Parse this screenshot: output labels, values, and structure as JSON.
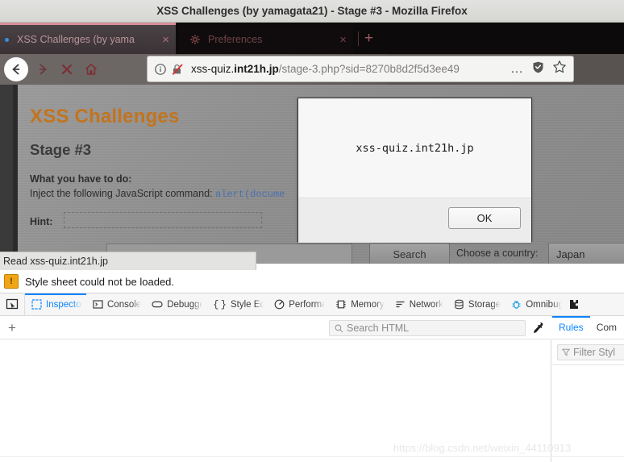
{
  "window": {
    "title": "XSS Challenges (by yamagata21) - Stage #3 - Mozilla Firefox"
  },
  "tabs": [
    {
      "label": "XSS Challenges (by yama",
      "close": "×",
      "active": true,
      "favicon": "dot-icon"
    },
    {
      "label": "Preferences",
      "close": "×",
      "active": false,
      "favicon": "gear-icon"
    }
  ],
  "tabstrip": {
    "new_tab": "+"
  },
  "navbar": {
    "back": "←",
    "forward": "→",
    "stop": "✕",
    "home": "⌂"
  },
  "urlbar": {
    "url_prefix": "xss-quiz.",
    "url_domain": "int21h.jp",
    "url_path": "/stage-3.php?sid=8270b8d2f5d3ee49",
    "full_url": "xss-quiz.int21h.jp/stage-3.php?sid=8270b8d2f5d3ee49",
    "identity_icon": "info-circle-icon",
    "insecure_icon": "broken-lock-icon",
    "page_actions": "…",
    "shield_icon": "shield-icon",
    "bookmark_icon": "star-icon"
  },
  "page": {
    "heading": "XSS Challenges",
    "stage": "Stage #3",
    "todo_label": "What you have to do:",
    "todo_text": "Inject the following JavaScript command: ",
    "todo_code": "alert(docume",
    "hint_label": "Hint:",
    "hint_value": "",
    "search_value": "",
    "search_button": "Search",
    "country_label": "Choose a country:",
    "country_value": "Japan",
    "heading_color": "#c2741f"
  },
  "dialog": {
    "message": "xss-quiz.int21h.jp",
    "ok_button": "OK"
  },
  "statustip": {
    "text": "Read xss-quiz.int21h.jp"
  },
  "notification": {
    "icon": "warning-icon",
    "icon_glyph": "!",
    "text": "Style sheet could not be loaded."
  },
  "devtools": {
    "picker_icon": "element-picker-icon",
    "tabs": [
      {
        "label": "Inspector",
        "icon": "inspector-icon",
        "selected": true
      },
      {
        "label": "Console",
        "icon": "console-icon",
        "selected": false
      },
      {
        "label": "Debugger",
        "icon": "debugger-icon",
        "selected": false
      },
      {
        "label": "Style Editor",
        "icon": "style-editor-icon",
        "selected": false
      },
      {
        "label": "Performance",
        "icon": "performance-icon",
        "selected": false
      },
      {
        "label": "Memory",
        "icon": "memory-icon",
        "selected": false
      },
      {
        "label": "Network",
        "icon": "network-icon",
        "selected": false
      },
      {
        "label": "Storage",
        "icon": "storage-icon",
        "selected": false
      },
      {
        "label": "Omnibug",
        "icon": "omnibug-icon",
        "selected": false
      }
    ],
    "add_node": "+",
    "search_html_placeholder": "Search HTML",
    "search_html_icon": "search-icon",
    "eyedropper_icon": "eyedropper-icon",
    "right_tabs": [
      {
        "label": "Rules",
        "selected": true
      },
      {
        "label": "Com",
        "selected": false
      }
    ],
    "filter_placeholder": "Filter Styl",
    "filter_icon": "filter-icon",
    "accent_color": "#0b84ff"
  },
  "watermark": {
    "text": "https://blog.csdn.net/weixin_44110913"
  }
}
